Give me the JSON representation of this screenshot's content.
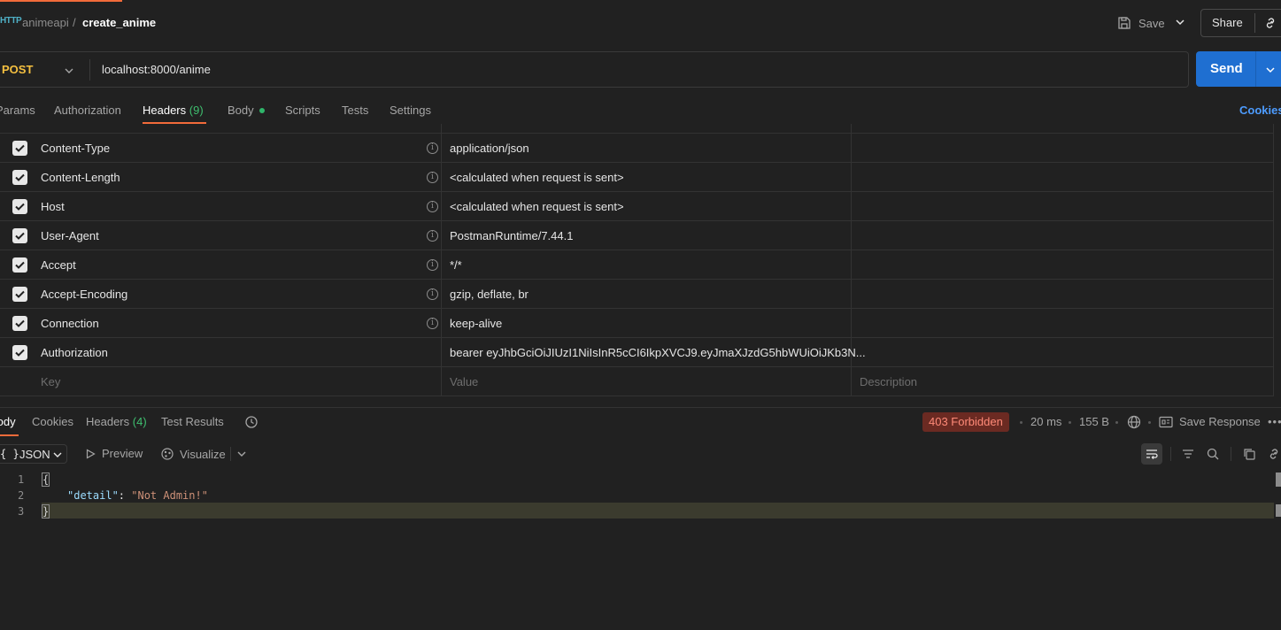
{
  "breadcrumb": {
    "method_icon": "HTTP",
    "collection": "animeapi",
    "separator": "/",
    "request_name": "create_anime"
  },
  "toolbar": {
    "save_label": "Save",
    "share_label": "Share"
  },
  "request": {
    "method": "POST",
    "url": "localhost:8000/anime",
    "send_label": "Send"
  },
  "tabs": {
    "params": "Params",
    "authorization": "Authorization",
    "headers": "Headers",
    "headers_count": "(9)",
    "body": "Body",
    "scripts": "Scripts",
    "tests": "Tests",
    "settings": "Settings",
    "cookies": "Cookies"
  },
  "headers": [
    {
      "key": "Content-Type",
      "value": "application/json"
    },
    {
      "key": "Content-Length",
      "value": "<calculated when request is sent>"
    },
    {
      "key": "Host",
      "value": "<calculated when request is sent>"
    },
    {
      "key": "User-Agent",
      "value": "PostmanRuntime/7.44.1"
    },
    {
      "key": "Accept",
      "value": "*/*"
    },
    {
      "key": "Accept-Encoding",
      "value": "gzip, deflate, br"
    },
    {
      "key": "Connection",
      "value": "keep-alive"
    },
    {
      "key": "Authorization",
      "value": "bearer eyJhbGciOiJIUzI1NiIsInR5cCI6IkpXVCJ9.eyJmaXJzdG5hbWUiOiJKb3N..."
    }
  ],
  "placeholders": {
    "key": "Key",
    "value": "Value",
    "description": "Description"
  },
  "response": {
    "tabs": {
      "body": "Body",
      "cookies": "Cookies",
      "headers": "Headers",
      "headers_count": "(4)",
      "test_results": "Test Results"
    },
    "status": "403 Forbidden",
    "time": "20 ms",
    "size": "155 B",
    "save_response": "Save Response",
    "format": "JSON",
    "preview": "Preview",
    "visualize": "Visualize",
    "line_numbers": [
      "1",
      "2",
      "3"
    ],
    "json_open": "{",
    "json_key": "\"detail\"",
    "json_colon": ": ",
    "json_value": "\"Not Admin!\"",
    "json_close": "}"
  },
  "colors": {
    "accent": "#f26b3a",
    "send": "#1f6fd1",
    "status_error_bg": "#6b2a22",
    "method_post": "#f5c040"
  }
}
